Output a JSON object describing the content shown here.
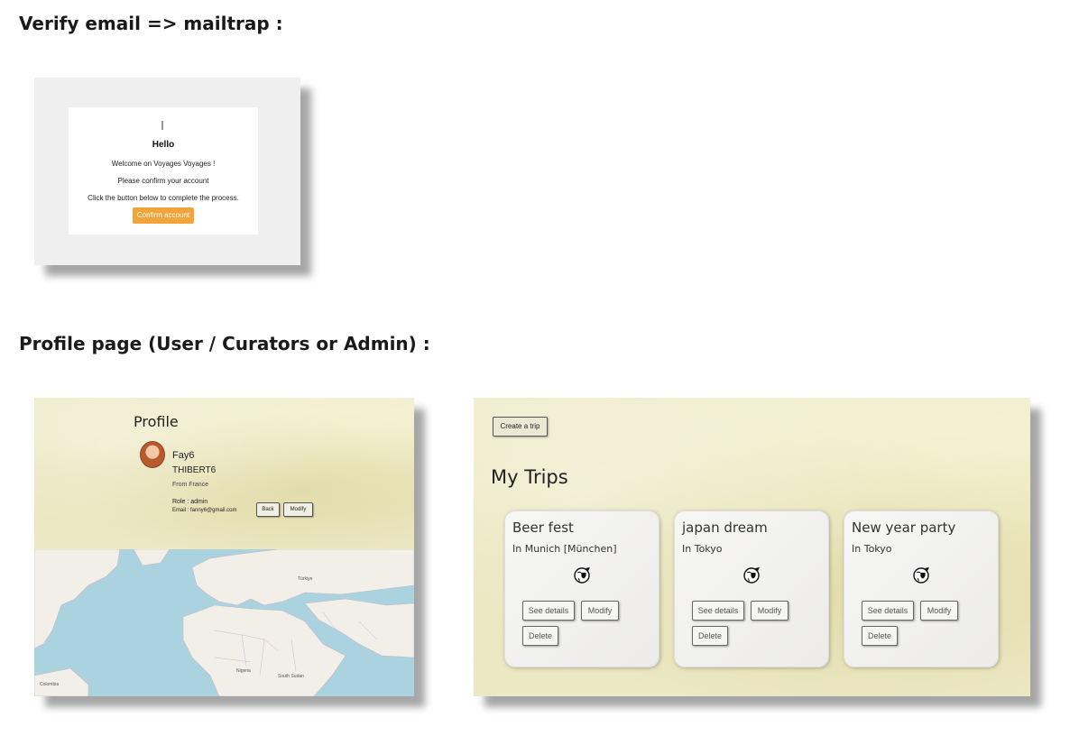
{
  "headings": {
    "verify": "Verify email => mailtrap :",
    "profile": "Profile page (User / Curators or Admin) :"
  },
  "email": {
    "hello": "Hello",
    "line1": "Welcome on Voyages Voyages !",
    "line2": "Please confirm your account",
    "line3": "Click the button below to complete the process.",
    "button": "Confirm account",
    "button_color": "#f0a43a"
  },
  "profile": {
    "title": "Profile",
    "first_name": "Fay6",
    "last_name": "THIBERT6",
    "from": "From France",
    "role": "Role : admin",
    "email": "Email : fanny6@gmail.com",
    "back_button": "Back",
    "modify_button": "Modify",
    "map_labels": [
      "Colombia",
      "Nigeria",
      "South Sudan",
      "Türkiye"
    ]
  },
  "trips": {
    "create_button": "Create a trip",
    "title": "My Trips",
    "cards": [
      {
        "name": "Beer fest",
        "city": "In Munich [München]",
        "details": "See details",
        "modify": "Modify",
        "delete": "Delete"
      },
      {
        "name": "japan dream",
        "city": "In Tokyo",
        "details": "See details",
        "modify": "Modify",
        "delete": "Delete"
      },
      {
        "name": "New year party",
        "city": "In Tokyo",
        "details": "See details",
        "modify": "Modify",
        "delete": "Delete"
      }
    ],
    "icon": "globe-icon"
  }
}
